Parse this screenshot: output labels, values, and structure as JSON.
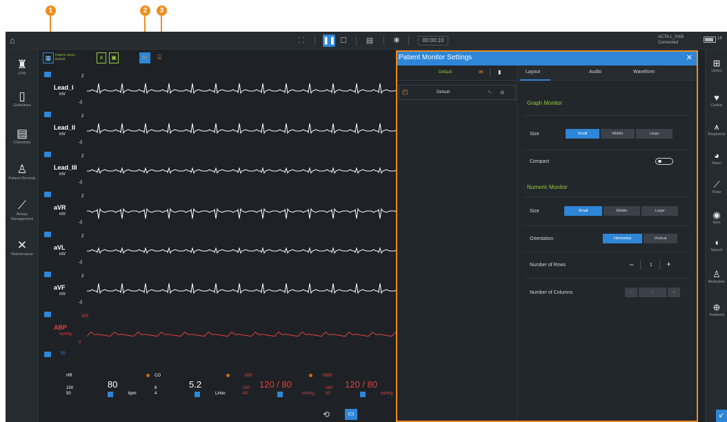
{
  "callouts": [
    "1",
    "2",
    "3"
  ],
  "topbar": {
    "timer": "00:00:10",
    "device_name": "ACT8-L_0005",
    "device_status": "Connected",
    "battery_label": "16"
  },
  "left_nav": [
    {
      "label": "CPR",
      "icon": "cpr-icon"
    },
    {
      "label": "Guidelines",
      "icon": "guidelines-icon"
    },
    {
      "label": "Checklists",
      "icon": "checklists-icon"
    },
    {
      "label": "Patient Records",
      "icon": "patient-records-icon"
    },
    {
      "label": "Airway Management",
      "icon": "airway-icon"
    },
    {
      "label": "Maintenance",
      "icon": "maintenance-icon"
    }
  ],
  "right_nav": [
    {
      "label": "Library",
      "icon": "library-icon"
    },
    {
      "label": "Cardiac",
      "icon": "cardiac-icon"
    },
    {
      "label": "Respiratory",
      "icon": "respiratory-icon"
    },
    {
      "label": "Neuro",
      "icon": "neuro-icon"
    },
    {
      "label": "Pulse",
      "icon": "pulse-icon"
    },
    {
      "label": "Eyes",
      "icon": "eyes-icon"
    },
    {
      "label": "Speech",
      "icon": "speech-icon"
    },
    {
      "label": "Medication",
      "icon": "medication-icon"
    },
    {
      "label": "Treatment",
      "icon": "treatment-icon"
    }
  ],
  "monitor_toolbar": {
    "library_line1": "Patient Library",
    "library_line2": "Default"
  },
  "waveforms": [
    {
      "lead": "Lead_I",
      "unit": "mV",
      "scale_top": "2",
      "scale_bottom": "-2",
      "color": "#ffffff",
      "kind": "ecg"
    },
    {
      "lead": "Lead_II",
      "unit": "mV",
      "scale_top": "2",
      "scale_bottom": "-2",
      "color": "#ffffff",
      "kind": "ecg"
    },
    {
      "lead": "Lead_III",
      "unit": "mV",
      "scale_top": "2",
      "scale_bottom": "-2",
      "color": "#ffffff",
      "kind": "ecg-small"
    },
    {
      "lead": "aVR",
      "unit": "mV",
      "scale_top": "2",
      "scale_bottom": "-2",
      "color": "#ffffff",
      "kind": "ecg-inverted"
    },
    {
      "lead": "aVL",
      "unit": "mV",
      "scale_top": "2",
      "scale_bottom": "-2",
      "color": "#ffffff",
      "kind": "ecg-small"
    },
    {
      "lead": "aVF",
      "unit": "mV",
      "scale_top": "2",
      "scale_bottom": "-2",
      "color": "#ffffff",
      "kind": "ecg"
    },
    {
      "lead": "ABP",
      "unit": "mmHg",
      "scale_top": "300",
      "scale_bottom": "0",
      "color": "#e0403c",
      "kind": "abp"
    }
  ],
  "extra_scale": "50",
  "numerics": {
    "hr": {
      "label": "HR",
      "value": "80",
      "hi": "150",
      "lo": "50",
      "unit": "bpm"
    },
    "co": {
      "label": "CO",
      "value": "5.2",
      "hi": "8",
      "lo": "4",
      "unit": "L/min"
    },
    "abp": {
      "label": "ABP",
      "value": "120 / 80",
      "hi": "160",
      "lo": "40",
      "unit": "mmHg"
    },
    "nibp": {
      "label": "NIBP",
      "value": "120 / 80",
      "hi": "160",
      "lo": "40",
      "unit": "mmHg"
    }
  },
  "settings": {
    "title": "Patient Monitor Settings",
    "profiles_header": "Default",
    "profile_item": "Default",
    "tabs": [
      "Layout",
      "Audio",
      "Waveform"
    ],
    "graph_section": "Graph Monitor",
    "graph_size_label": "Size",
    "graph_size_options": [
      "Small",
      "Middle",
      "Large"
    ],
    "graph_size_selected": "Small",
    "compact_label": "Compact",
    "numeric_section": "Numeric Monitor",
    "numeric_size_label": "Size",
    "numeric_size_options": [
      "Small",
      "Middle",
      "Large"
    ],
    "numeric_size_selected": "Small",
    "orientation_label": "Orientation",
    "orientation_options": [
      "Horizontal",
      "Vertical"
    ],
    "orientation_selected": "Horizontal",
    "rows_label": "Number of Rows",
    "rows_value": "1",
    "columns_label": "Number of Columns",
    "columns_value": "1"
  },
  "colors": {
    "accent": "#2e86d8",
    "highlight": "#f08c1e",
    "section_green": "#9acb3c",
    "alarm_red": "#e0403c"
  }
}
